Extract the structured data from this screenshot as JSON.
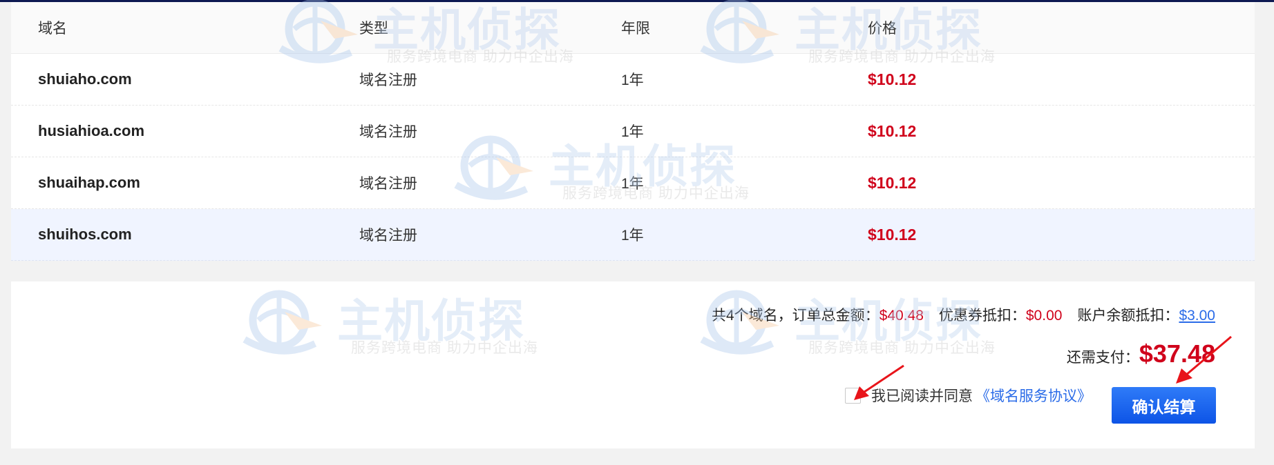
{
  "table": {
    "headers": {
      "name": "域名",
      "type": "类型",
      "years": "年限",
      "price": "价格"
    },
    "rows": [
      {
        "name": "shuiaho.com",
        "type": "域名注册",
        "years": "1年",
        "price": "$10.12"
      },
      {
        "name": "husiahioa.com",
        "type": "域名注册",
        "years": "1年",
        "price": "$10.12"
      },
      {
        "name": "shuaihap.com",
        "type": "域名注册",
        "years": "1年",
        "price": "$10.12"
      },
      {
        "name": "shuihos.com",
        "type": "域名注册",
        "years": "1年",
        "price": "$10.12"
      }
    ]
  },
  "summary": {
    "count_prefix": "共 ",
    "count": "4",
    "count_suffix": " 个域名，订单总金额：",
    "total": "$40.48",
    "coupon_label": "优惠券抵扣：",
    "coupon": "$0.00",
    "balance_label": "账户余额抵扣：",
    "balance": "$3.00",
    "due_label": "还需支付：",
    "due": "$37.48"
  },
  "agreement": {
    "text": "我已阅读并同意",
    "link": "《域名服务协议》",
    "checked": false
  },
  "confirm_button": "确认结算",
  "watermark": {
    "title": "主机侦探",
    "tagline": "服务跨境电商 助力中企出海"
  },
  "colors": {
    "price_red": "#d0021b",
    "link_blue": "#2a6be8",
    "button_blue": "#1565f0",
    "annotation_arrow": "#e8141a"
  }
}
